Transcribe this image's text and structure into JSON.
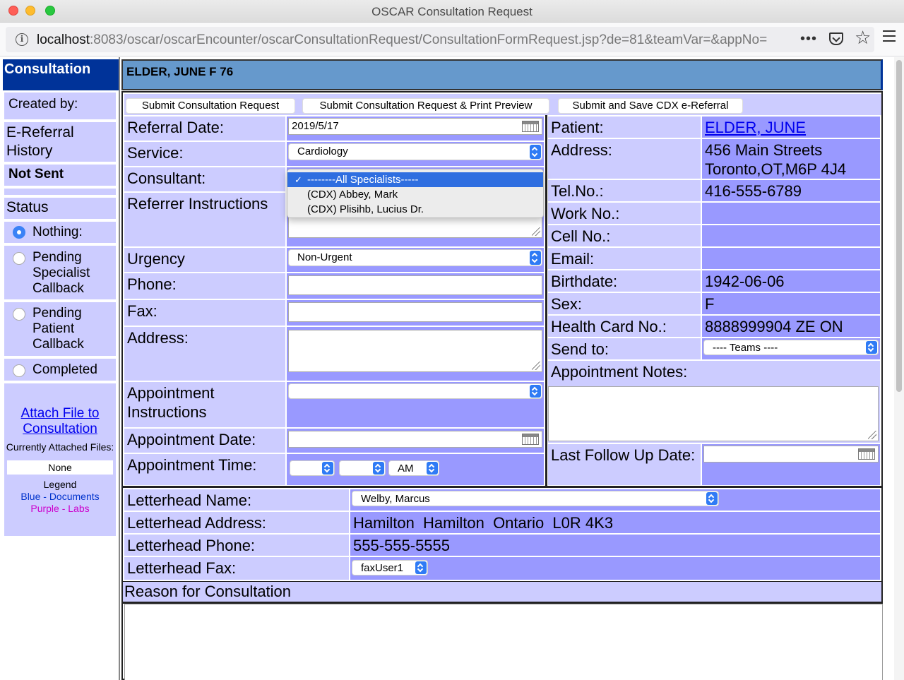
{
  "window": {
    "title": "OSCAR Consultation Request"
  },
  "urlbar": {
    "host": "localhost",
    "path": ":8083/oscar/oscarEncounter/oscarConsultationRequest/ConsultationFormRequest.jsp?de=81&teamVar=&appNo="
  },
  "sidebar": {
    "brand": "Consultation",
    "created_by": "Created by:",
    "ereferral_history": "E-Referral History",
    "not_sent": "Not Sent",
    "status_title": "Status",
    "status_options": [
      {
        "label": "Nothing:",
        "selected": true
      },
      {
        "label": "Pending Specialist Callback",
        "selected": false
      },
      {
        "label": "Pending Patient Callback",
        "selected": false
      },
      {
        "label": "Completed",
        "selected": false
      }
    ],
    "attach_link": "Attach File to Consultation",
    "currently_attached": "Currently Attached Files:",
    "none": "None",
    "legend": "Legend",
    "legend_blue": "Blue - Documents",
    "legend_purple": "Purple - Labs"
  },
  "header": {
    "patient_banner": "ELDER, JUNE F 76"
  },
  "buttons": {
    "submit": "Submit Consultation Request",
    "submit_print": "Submit Consultation Request & Print Preview",
    "submit_cdx": "Submit and Save CDX e-Referral"
  },
  "form": {
    "referral_date_label": "Referral Date:",
    "referral_date_value": "2019/5/17",
    "service_label": "Service:",
    "service_value": "Cardiology",
    "consultant_label": "Consultant:",
    "consultant_options": [
      "--------All Specialists-----",
      "(CDX) Abbey, Mark",
      "(CDX) Plisihb, Lucius Dr."
    ],
    "referrer_instructions_label": "Referrer Instructions",
    "urgency_label": "Urgency",
    "urgency_value": "Non-Urgent",
    "phone_label": "Phone:",
    "phone_value": "",
    "fax_label": "Fax:",
    "fax_value": "",
    "address_label": "Address:",
    "address_value": "",
    "appointment_instructions_label": "Appointment Instructions",
    "appointment_instructions_value": "",
    "appointment_date_label": "Appointment Date:",
    "appointment_date_value": "",
    "appointment_time_label": "Appointment Time:",
    "appointment_time_hour": "",
    "appointment_time_minute": "",
    "appointment_time_ampm": "AM"
  },
  "patient": {
    "patient_label": "Patient:",
    "patient_name": "ELDER, JUNE",
    "address_label": "Address:",
    "address_line1": "456 Main Streets",
    "address_line2": "Toronto,OT,M6P 4J4",
    "tel_label": "Tel.No.:",
    "tel_value": "416-555-6789",
    "work_label": "Work No.:",
    "work_value": "",
    "cell_label": "Cell No.:",
    "cell_value": "",
    "email_label": "Email:",
    "email_value": "",
    "birthdate_label": "Birthdate:",
    "birthdate_value": "1942-06-06",
    "sex_label": "Sex:",
    "sex_value": "F",
    "hc_label": "Health Card No.:",
    "hc_value": "8888999904 ZE ON",
    "send_to_label": "Send to:",
    "send_to_value": "---- Teams ----",
    "appointment_notes_label": "Appointment Notes:",
    "last_follow_up_label": "Last Follow Up Date:",
    "last_follow_up_value": ""
  },
  "letterhead": {
    "name_label": "Letterhead Name:",
    "name_value": "Welby, Marcus",
    "address_label": "Letterhead Address:",
    "address_value": "Hamilton  Hamilton  Ontario  L0R 4K3",
    "phone_label": "Letterhead Phone:",
    "phone_value": "555-555-5555",
    "fax_label": "Letterhead Fax:",
    "fax_value": "faxUser1"
  },
  "reason": {
    "title": "Reason for Consultation",
    "value": ""
  }
}
